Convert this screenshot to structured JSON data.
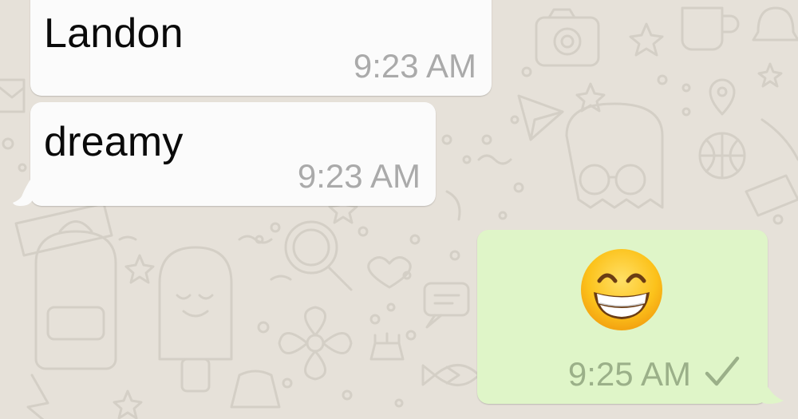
{
  "chat": {
    "wallpaper_color": "#e6e1d9",
    "incoming_bubble_color": "#fbfbfb",
    "outgoing_bubble_color": "#dff5c8",
    "messages": [
      {
        "direction": "incoming",
        "text": "Landon",
        "time": "9:23 AM"
      },
      {
        "direction": "incoming",
        "text": "dreamy",
        "time": "9:23 AM"
      },
      {
        "direction": "outgoing",
        "emoji": "grinning-face-with-smiling-eyes",
        "time": "9:25 AM",
        "status_icon": "single-check-icon"
      }
    ]
  }
}
